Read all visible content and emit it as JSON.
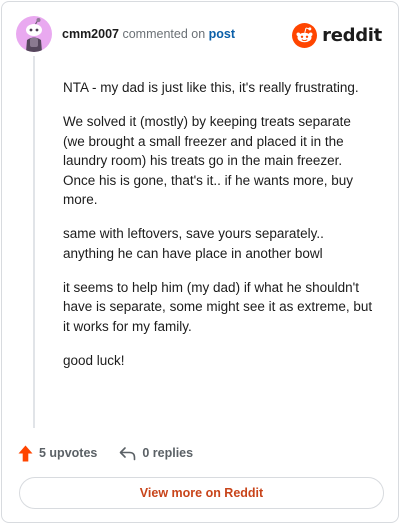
{
  "comment": {
    "username": "cmm2007",
    "action_text": "commented on",
    "post_link_label": "post",
    "paragraphs": [
      "NTA - my dad is just like this, it's really frustrating.",
      "We solved it (mostly) by keeping treats separate (we brought a small freezer and placed it in the laundry room) his treats go in the main freezer. Once his is gone, that's it.. if he wants more, buy more.",
      "same with leftovers, save yours separately.. anything he can have place in another bowl",
      "it seems to help him (my dad) if what he shouldn't have is separate, some might see it as extreme, but it works for my family.",
      "good luck!"
    ]
  },
  "brand": {
    "name": "reddit",
    "color": "#ff4500"
  },
  "actions": {
    "upvotes_label": "5 upvotes",
    "replies_label": "0 replies"
  },
  "footer": {
    "view_more_label": "View more on Reddit"
  },
  "icons": {
    "avatar": "snoo-avatar-icon",
    "logo": "reddit-logo-icon",
    "upvote": "upvote-arrow-icon",
    "reply": "reply-arrow-icon"
  },
  "colors": {
    "accent": "#c8441a",
    "upvote": "#ff4500",
    "link": "#0a5fa8",
    "avatar_bg": "#e9a9f0"
  }
}
